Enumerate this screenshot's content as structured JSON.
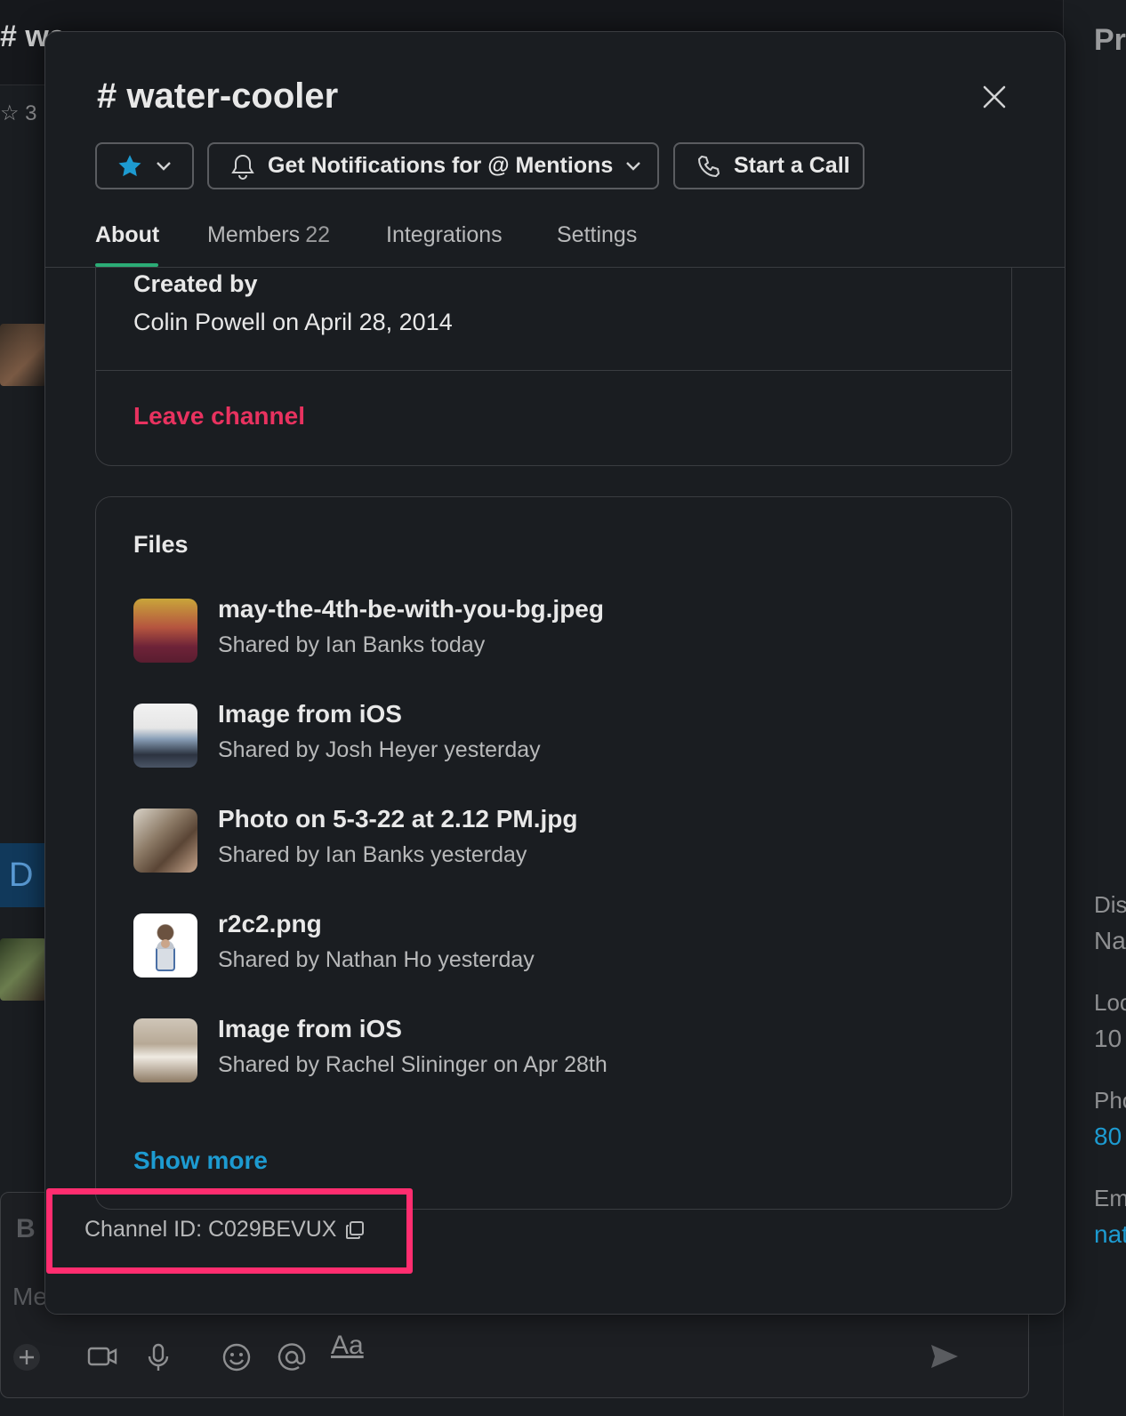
{
  "background": {
    "channel_title_partial": "# wa",
    "stat_partial": "☆ 3",
    "right_panel_head": "Pr",
    "profile_partial": [
      "Dis",
      "Na",
      "Loc",
      "10",
      "Pho",
      "80",
      "Em",
      "nat"
    ],
    "avatar_letter": "D",
    "composer_bold": "B",
    "composer_placeholder_partial": "Me",
    "composer_format": "Aa"
  },
  "modal": {
    "title": "# water-cooler",
    "buttons": {
      "notifications": "Get Notifications for @ Mentions",
      "call": "Start a Call"
    },
    "tabs": [
      {
        "label": "About",
        "active": true
      },
      {
        "label": "Members",
        "count": "22"
      },
      {
        "label": "Integrations"
      },
      {
        "label": "Settings"
      }
    ],
    "about": {
      "created_by_label": "Created by",
      "created_by_value": "Colin Powell on April 28, 2014",
      "leave": "Leave channel"
    },
    "files": {
      "heading": "Files",
      "items": [
        {
          "name": "may-the-4th-be-with-you-bg.jpeg",
          "meta": "Shared by Ian Banks today"
        },
        {
          "name": "Image from iOS",
          "meta": "Shared by Josh Heyer yesterday"
        },
        {
          "name": "Photo on 5-3-22 at 2.12 PM.jpg",
          "meta": "Shared by Ian Banks yesterday"
        },
        {
          "name": "r2c2.png",
          "meta": "Shared by Nathan Ho yesterday"
        },
        {
          "name": "Image from iOS",
          "meta": "Shared by Rachel Slininger on Apr 28th"
        }
      ],
      "show_more": "Show more"
    },
    "channel_id": "Channel ID: C029BEVUX"
  },
  "colors": {
    "accent_green": "#2bac76",
    "danger": "#e8325f",
    "link": "#1d9bd1",
    "highlight": "#ff2d6f",
    "star": "#1d9bd1"
  }
}
